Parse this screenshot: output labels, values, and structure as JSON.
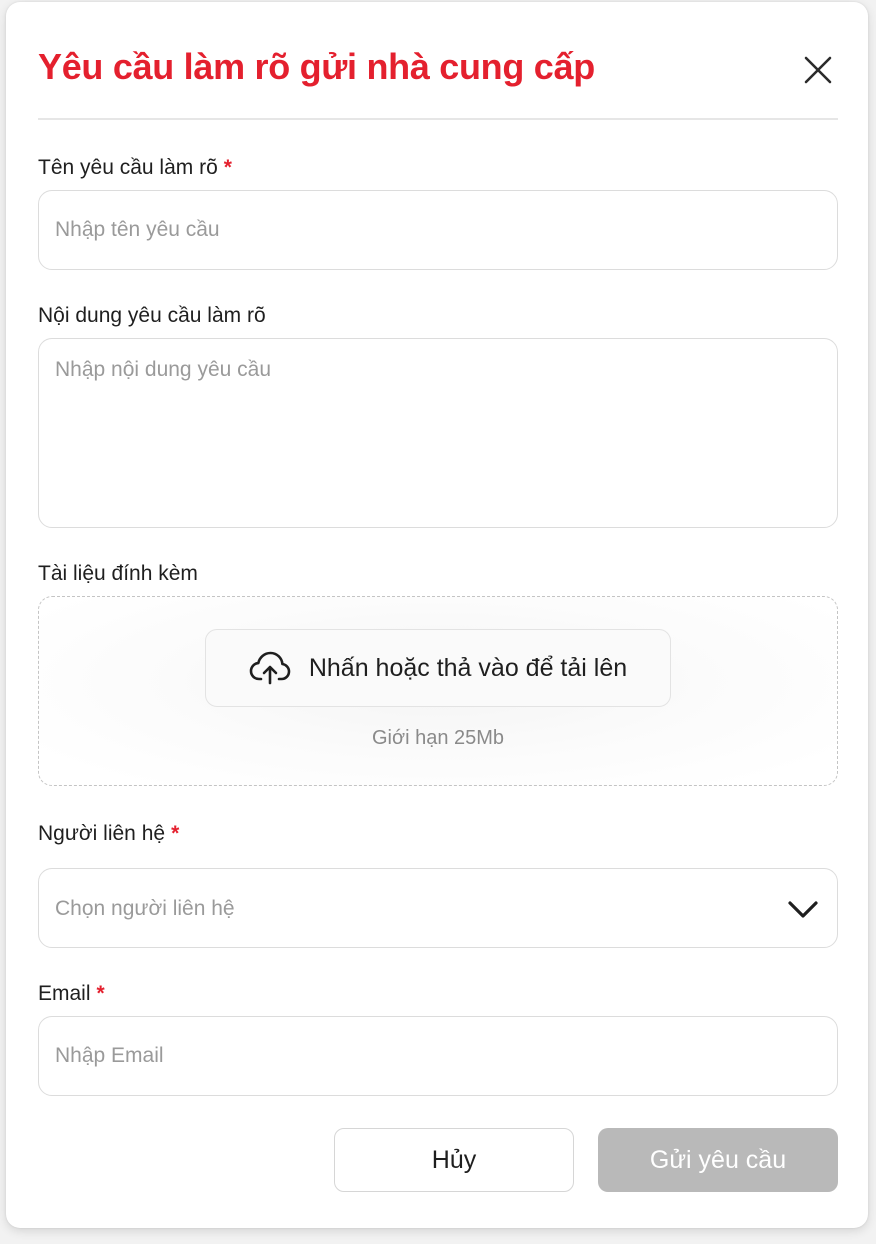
{
  "modal": {
    "title": "Yêu cầu làm rõ gửi nhà cung cấp",
    "close_icon": "close-icon",
    "accent_color": "#e4202e"
  },
  "fields": {
    "request_name": {
      "label": "Tên yêu cầu làm rõ",
      "required_mark": "*",
      "value": "",
      "placeholder": "Nhập tên yêu cầu"
    },
    "request_content": {
      "label": "Nội dung yêu cầu làm rõ",
      "value": "",
      "placeholder": "Nhập nội dung yêu cầu"
    },
    "attachments": {
      "label": "Tài liệu đính kèm",
      "upload_icon": "cloud-upload-icon",
      "upload_label": "Nhấn hoặc thả vào để tải lên",
      "limit_text": "Giới hạn 25Mb"
    },
    "contact": {
      "label": "Người liên hệ",
      "required_mark": "*",
      "selected": "Chọn người liên hệ",
      "dropdown_icon": "chevron-down-icon"
    },
    "email": {
      "label": "Email",
      "required_mark": "*",
      "value": "",
      "placeholder": "Nhập Email"
    }
  },
  "actions": {
    "cancel_label": "Hủy",
    "submit_label": "Gửi yêu cầu",
    "submit_disabled_color": "#b9b9b9"
  }
}
